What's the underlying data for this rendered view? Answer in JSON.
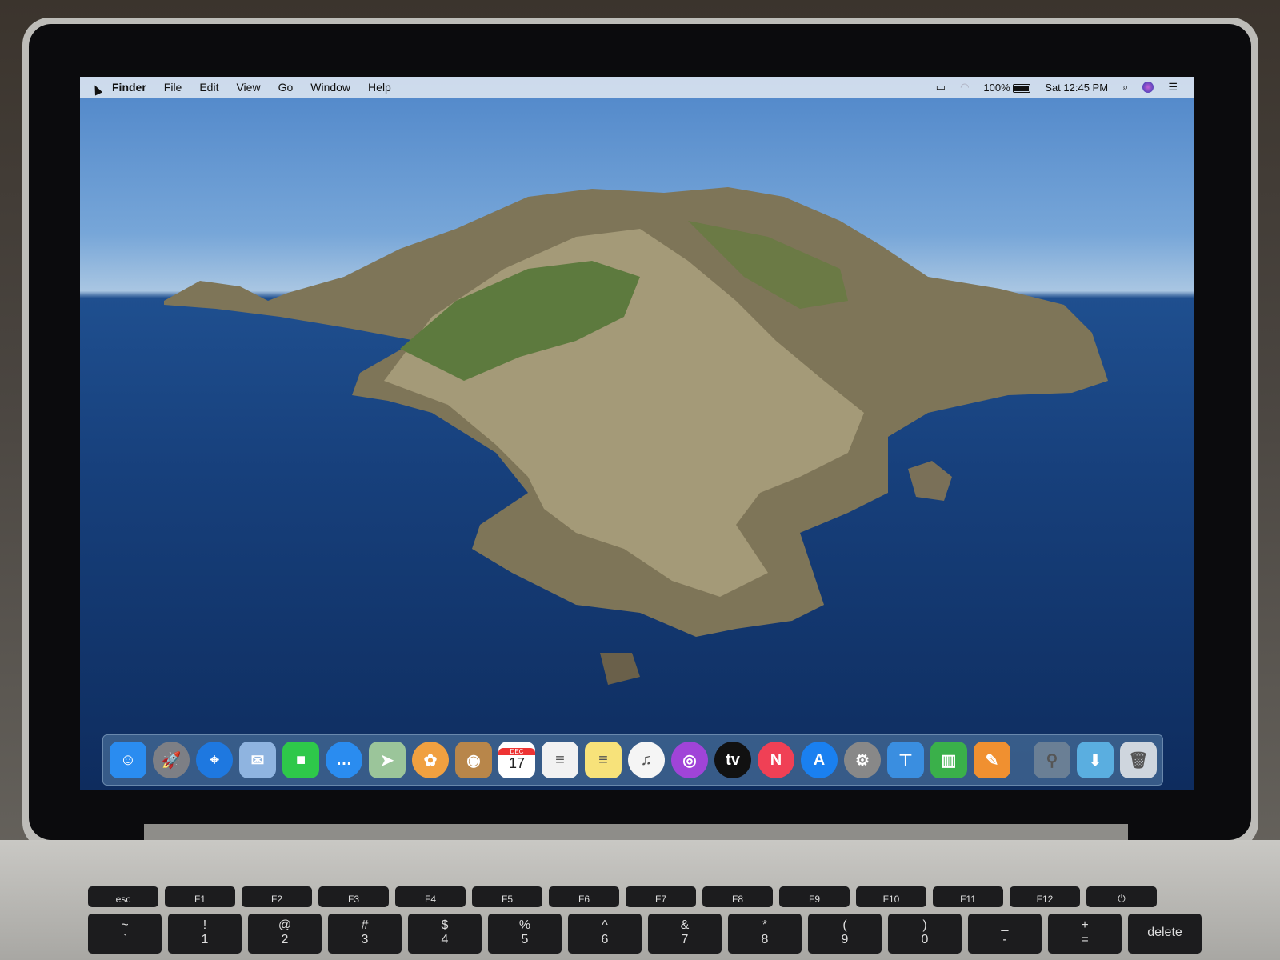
{
  "menubar": {
    "app": "Finder",
    "items": [
      "File",
      "Edit",
      "View",
      "Go",
      "Window",
      "Help"
    ],
    "battery": "100%",
    "clock": "Sat 12:45 PM"
  },
  "dock": {
    "apps": [
      {
        "name": "Finder",
        "color": "#2a8cf0",
        "glyph": "☺"
      },
      {
        "name": "Launchpad",
        "color": "#7d7f85",
        "glyph": "🚀"
      },
      {
        "name": "Safari",
        "color": "#1e78e0",
        "glyph": "⌖"
      },
      {
        "name": "Mail",
        "color": "#8fb4e0",
        "glyph": "✉"
      },
      {
        "name": "FaceTime",
        "color": "#2ec84a",
        "glyph": "■"
      },
      {
        "name": "Messages",
        "color": "#2a8cf0",
        "glyph": "…"
      },
      {
        "name": "Maps",
        "color": "#9bc59a",
        "glyph": "➤"
      },
      {
        "name": "Photos",
        "color": "#f0a040",
        "glyph": "✿"
      },
      {
        "name": "Contacts",
        "color": "#b8864a",
        "glyph": "◉"
      },
      {
        "name": "Calendar",
        "color": "#ffffff",
        "glyph": "17",
        "month": "DEC"
      },
      {
        "name": "Reminders",
        "color": "#f2f2f2",
        "glyph": "≡"
      },
      {
        "name": "Notes",
        "color": "#f7e27a",
        "glyph": "≡"
      },
      {
        "name": "Music",
        "color": "#f5f5f5",
        "glyph": "♫"
      },
      {
        "name": "Podcasts",
        "color": "#a044d8",
        "glyph": "◎"
      },
      {
        "name": "TV",
        "color": "#111111",
        "glyph": "tv"
      },
      {
        "name": "News",
        "color": "#f04055",
        "glyph": "N"
      },
      {
        "name": "App Store",
        "color": "#1a80f0",
        "glyph": "A"
      },
      {
        "name": "System Preferences",
        "color": "#888888",
        "glyph": "⚙"
      },
      {
        "name": "Keynote",
        "color": "#3a8ee0",
        "glyph": "⊤"
      },
      {
        "name": "Numbers",
        "color": "#3ab04a",
        "glyph": "▥"
      },
      {
        "name": "Pages",
        "color": "#f09030",
        "glyph": "✎"
      }
    ],
    "utilities": [
      {
        "name": "Utility",
        "color": "#6a7f95",
        "glyph": "⚲"
      },
      {
        "name": "Downloads",
        "color": "#5aaee0",
        "glyph": "⬇"
      },
      {
        "name": "Trash",
        "color": "#cfd6de",
        "glyph": "🗑"
      }
    ]
  },
  "keyboard": {
    "fn_row": [
      "esc",
      "F1",
      "F2",
      "F3",
      "F4",
      "F5",
      "F6",
      "F7",
      "F8",
      "F9",
      "F10",
      "F11",
      "F12",
      "⏻"
    ],
    "num_row": [
      [
        "~",
        "`"
      ],
      [
        "!",
        "1"
      ],
      [
        "@",
        "2"
      ],
      [
        "#",
        "3"
      ],
      [
        "$",
        "4"
      ],
      [
        "%",
        "5"
      ],
      [
        "^",
        "6"
      ],
      [
        "&",
        "7"
      ],
      [
        "*",
        "8"
      ],
      [
        "(",
        "9"
      ],
      [
        ")",
        "0"
      ],
      [
        "_",
        "-"
      ],
      [
        "+",
        "="
      ],
      [
        "",
        "delete"
      ]
    ]
  }
}
